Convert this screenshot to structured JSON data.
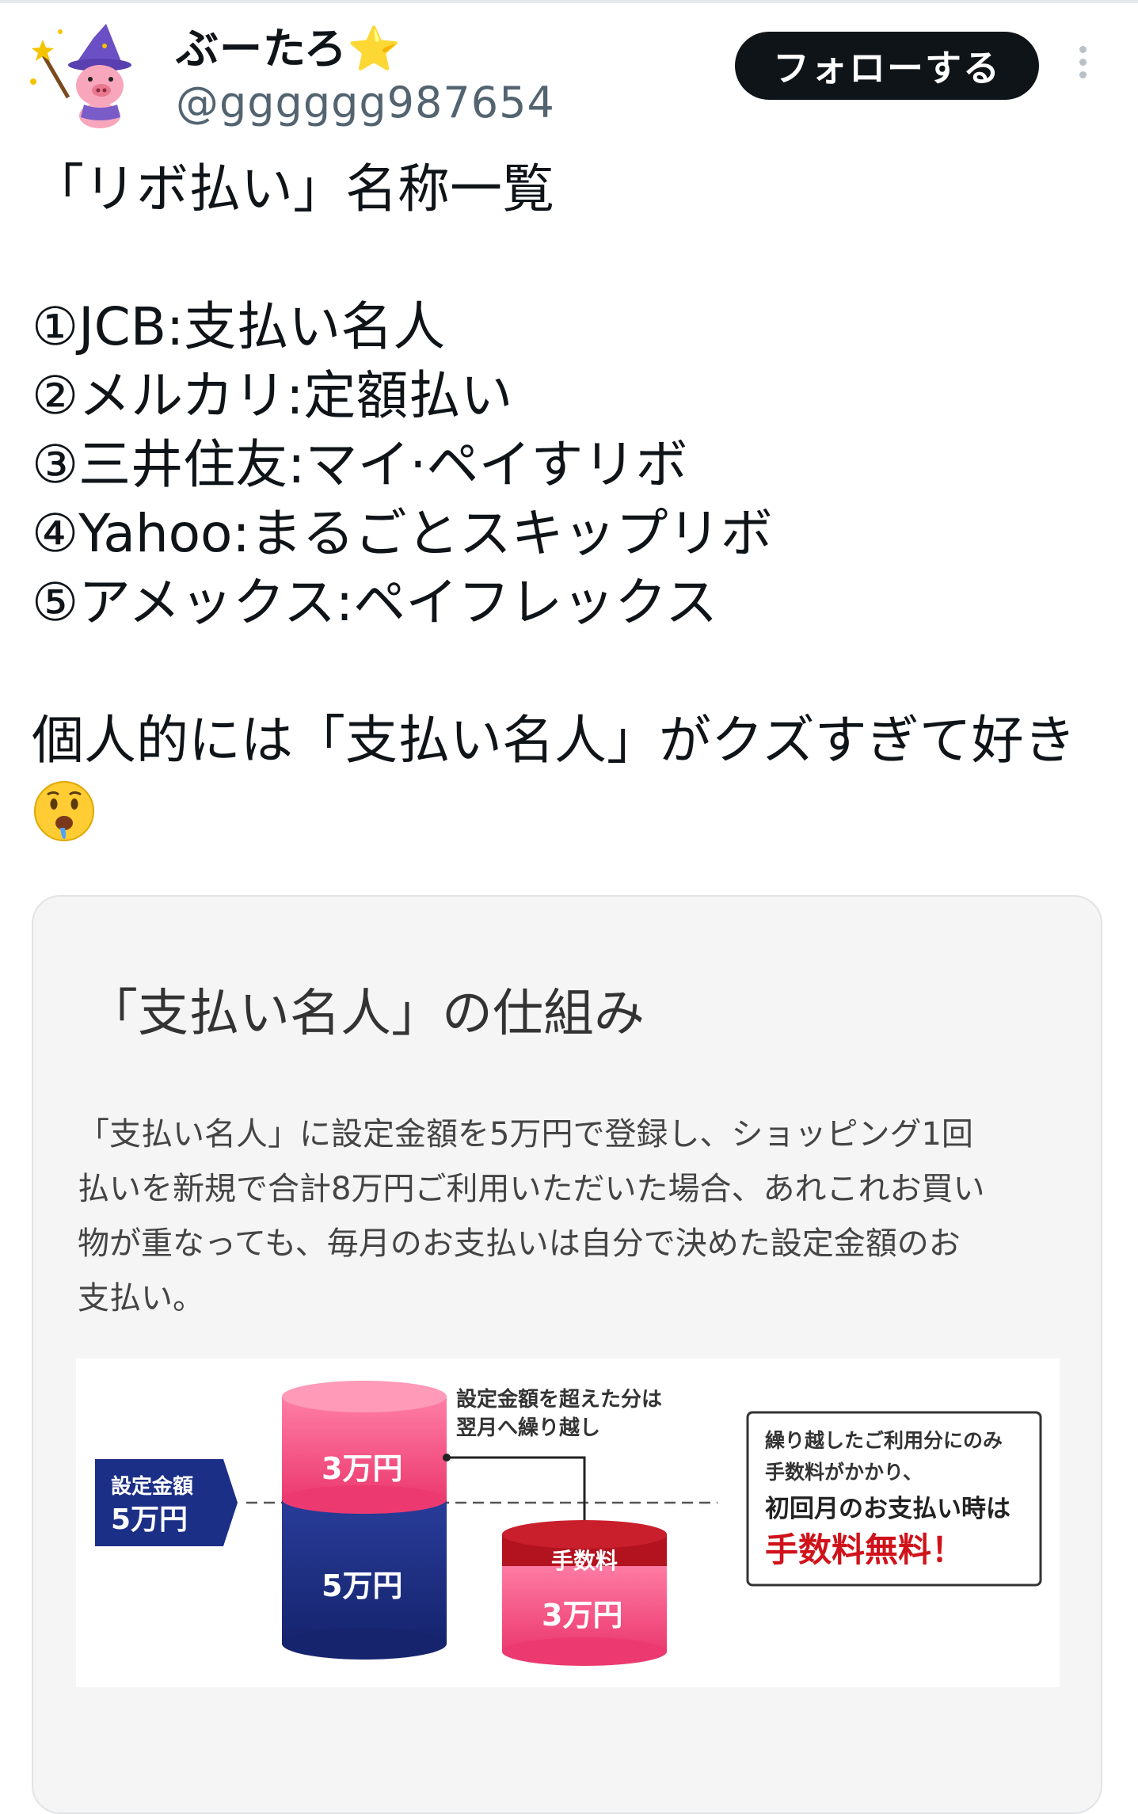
{
  "header": {
    "display_name": "ぶーたろ",
    "name_emoji": "⭐",
    "handle": "@gggggg987654",
    "follow_label": "フォローする",
    "more_icon": "more-vertical-icon",
    "avatar_icon": "wizard-pig-avatar"
  },
  "tweet": {
    "title": "「リボ払い」名称一覧",
    "items": [
      "①JCB:支払い名人",
      "②メルカリ:定額払い",
      "③三井住友:マイ·ペイすリボ",
      "④Yahoo:まるごとスキップリボ",
      "⑤アメックス:ペイフレックス"
    ],
    "comment": "個人的には「支払い名人」がクズすぎて好き",
    "comment_emoji": "drooling-face-emoji"
  },
  "card": {
    "title": "「支払い名人」の仕組み",
    "desc_lines": [
      "「支払い名人」に設定金額を5万円で登録し、ショッピング1回",
      "払いを新規で合計8万円ご利用いただいた場合、あれこれお買い",
      "物が重なっても、毎月のお支払いは自分で決めた設定金額のお",
      "支払い。"
    ],
    "diagram": {
      "setting_label": "設定金額",
      "setting_amount": "5万円",
      "stack_top": "3万円",
      "stack_bottom": "5万円",
      "carry_note_1": "設定金額を超えた分は",
      "carry_note_2": "翌月へ繰り越し",
      "fee_label": "手数料",
      "fee_amount": "3万円",
      "box_line_1": "繰り越したご利用分にのみ",
      "box_line_2": "手数料がかかり、",
      "box_line_3": "初回月のお支払い時は",
      "box_line_4": "手数料無料！",
      "colors": {
        "navy": "#1c2f86",
        "pink": "#f0457a",
        "dark_red": "#b3121f",
        "accent_red": "#d0121b"
      }
    }
  }
}
